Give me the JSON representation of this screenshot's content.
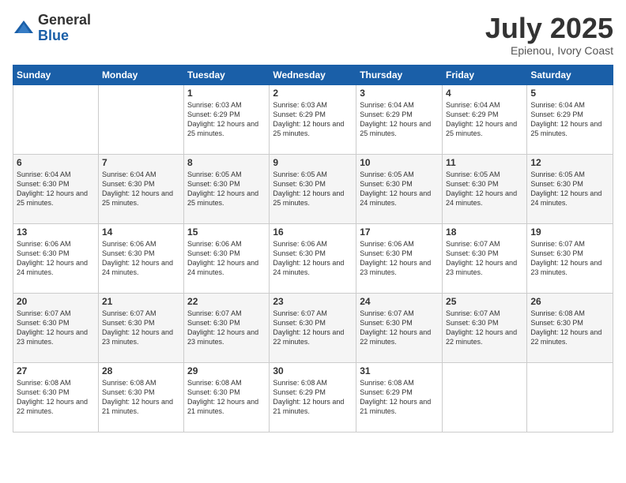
{
  "logo": {
    "general": "General",
    "blue": "Blue"
  },
  "header": {
    "month": "July 2025",
    "location": "Epienou, Ivory Coast"
  },
  "days_of_week": [
    "Sunday",
    "Monday",
    "Tuesday",
    "Wednesday",
    "Thursday",
    "Friday",
    "Saturday"
  ],
  "weeks": [
    [
      {
        "day": "",
        "info": ""
      },
      {
        "day": "",
        "info": ""
      },
      {
        "day": "1",
        "info": "Sunrise: 6:03 AM\nSunset: 6:29 PM\nDaylight: 12 hours and 25 minutes."
      },
      {
        "day": "2",
        "info": "Sunrise: 6:03 AM\nSunset: 6:29 PM\nDaylight: 12 hours and 25 minutes."
      },
      {
        "day": "3",
        "info": "Sunrise: 6:04 AM\nSunset: 6:29 PM\nDaylight: 12 hours and 25 minutes."
      },
      {
        "day": "4",
        "info": "Sunrise: 6:04 AM\nSunset: 6:29 PM\nDaylight: 12 hours and 25 minutes."
      },
      {
        "day": "5",
        "info": "Sunrise: 6:04 AM\nSunset: 6:29 PM\nDaylight: 12 hours and 25 minutes."
      }
    ],
    [
      {
        "day": "6",
        "info": "Sunrise: 6:04 AM\nSunset: 6:30 PM\nDaylight: 12 hours and 25 minutes."
      },
      {
        "day": "7",
        "info": "Sunrise: 6:04 AM\nSunset: 6:30 PM\nDaylight: 12 hours and 25 minutes."
      },
      {
        "day": "8",
        "info": "Sunrise: 6:05 AM\nSunset: 6:30 PM\nDaylight: 12 hours and 25 minutes."
      },
      {
        "day": "9",
        "info": "Sunrise: 6:05 AM\nSunset: 6:30 PM\nDaylight: 12 hours and 25 minutes."
      },
      {
        "day": "10",
        "info": "Sunrise: 6:05 AM\nSunset: 6:30 PM\nDaylight: 12 hours and 24 minutes."
      },
      {
        "day": "11",
        "info": "Sunrise: 6:05 AM\nSunset: 6:30 PM\nDaylight: 12 hours and 24 minutes."
      },
      {
        "day": "12",
        "info": "Sunrise: 6:05 AM\nSunset: 6:30 PM\nDaylight: 12 hours and 24 minutes."
      }
    ],
    [
      {
        "day": "13",
        "info": "Sunrise: 6:06 AM\nSunset: 6:30 PM\nDaylight: 12 hours and 24 minutes."
      },
      {
        "day": "14",
        "info": "Sunrise: 6:06 AM\nSunset: 6:30 PM\nDaylight: 12 hours and 24 minutes."
      },
      {
        "day": "15",
        "info": "Sunrise: 6:06 AM\nSunset: 6:30 PM\nDaylight: 12 hours and 24 minutes."
      },
      {
        "day": "16",
        "info": "Sunrise: 6:06 AM\nSunset: 6:30 PM\nDaylight: 12 hours and 24 minutes."
      },
      {
        "day": "17",
        "info": "Sunrise: 6:06 AM\nSunset: 6:30 PM\nDaylight: 12 hours and 23 minutes."
      },
      {
        "day": "18",
        "info": "Sunrise: 6:07 AM\nSunset: 6:30 PM\nDaylight: 12 hours and 23 minutes."
      },
      {
        "day": "19",
        "info": "Sunrise: 6:07 AM\nSunset: 6:30 PM\nDaylight: 12 hours and 23 minutes."
      }
    ],
    [
      {
        "day": "20",
        "info": "Sunrise: 6:07 AM\nSunset: 6:30 PM\nDaylight: 12 hours and 23 minutes."
      },
      {
        "day": "21",
        "info": "Sunrise: 6:07 AM\nSunset: 6:30 PM\nDaylight: 12 hours and 23 minutes."
      },
      {
        "day": "22",
        "info": "Sunrise: 6:07 AM\nSunset: 6:30 PM\nDaylight: 12 hours and 23 minutes."
      },
      {
        "day": "23",
        "info": "Sunrise: 6:07 AM\nSunset: 6:30 PM\nDaylight: 12 hours and 22 minutes."
      },
      {
        "day": "24",
        "info": "Sunrise: 6:07 AM\nSunset: 6:30 PM\nDaylight: 12 hours and 22 minutes."
      },
      {
        "day": "25",
        "info": "Sunrise: 6:07 AM\nSunset: 6:30 PM\nDaylight: 12 hours and 22 minutes."
      },
      {
        "day": "26",
        "info": "Sunrise: 6:08 AM\nSunset: 6:30 PM\nDaylight: 12 hours and 22 minutes."
      }
    ],
    [
      {
        "day": "27",
        "info": "Sunrise: 6:08 AM\nSunset: 6:30 PM\nDaylight: 12 hours and 22 minutes."
      },
      {
        "day": "28",
        "info": "Sunrise: 6:08 AM\nSunset: 6:30 PM\nDaylight: 12 hours and 21 minutes."
      },
      {
        "day": "29",
        "info": "Sunrise: 6:08 AM\nSunset: 6:30 PM\nDaylight: 12 hours and 21 minutes."
      },
      {
        "day": "30",
        "info": "Sunrise: 6:08 AM\nSunset: 6:29 PM\nDaylight: 12 hours and 21 minutes."
      },
      {
        "day": "31",
        "info": "Sunrise: 6:08 AM\nSunset: 6:29 PM\nDaylight: 12 hours and 21 minutes."
      },
      {
        "day": "",
        "info": ""
      },
      {
        "day": "",
        "info": ""
      }
    ]
  ]
}
